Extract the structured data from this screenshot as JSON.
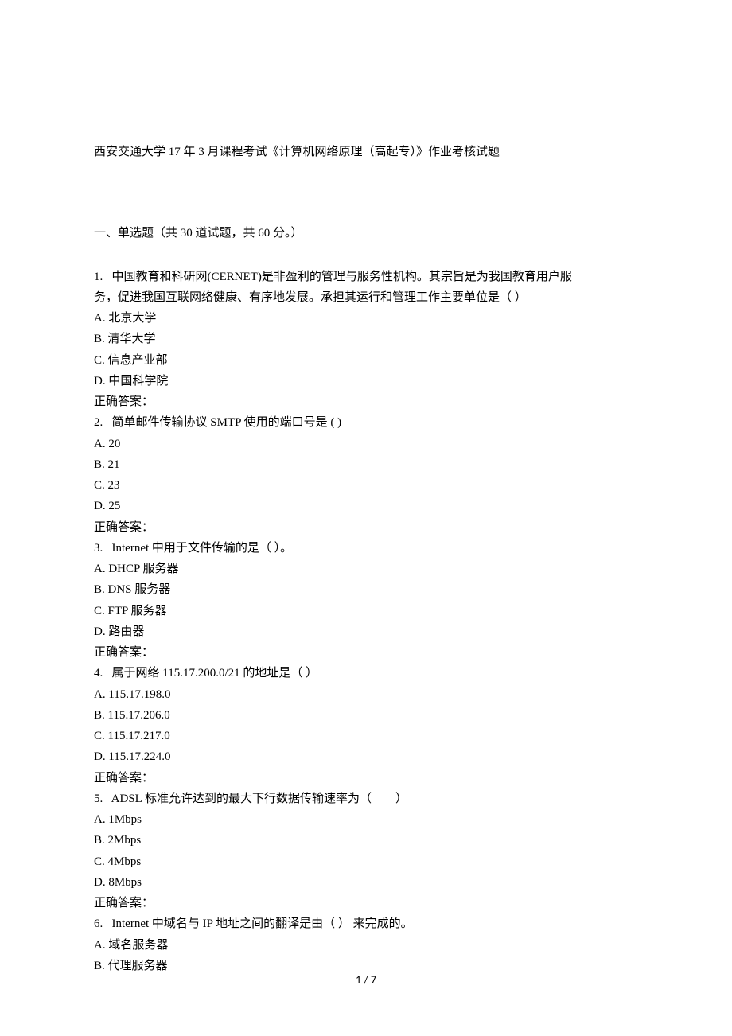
{
  "title": "西安交通大学 17 年 3 月课程考试《计算机网络原理（高起专）》作业考核试题",
  "section_header": "一、单选题（共 30 道试题，共 60 分。）",
  "questions": [
    {
      "num": "1.",
      "stem_lines": [
        "中国教育和科研网(CERNET)是非盈利的管理与服务性机构。其宗旨是为我国教育用户服",
        "务，促进我国互联网络健康、有序地发展。承担其运行和管理工作主要单位是（ ）"
      ],
      "options": [
        "A. 北京大学",
        "B. 清华大学",
        "C. 信息产业部",
        "D. 中国科学院"
      ],
      "answer_label": "正确答案："
    },
    {
      "num": "2.",
      "stem_lines": [
        "简单邮件传输协议 SMTP 使用的端口号是 ( )"
      ],
      "options": [
        "A. 20",
        "B. 21",
        "C. 23",
        "D. 25"
      ],
      "answer_label": "正确答案："
    },
    {
      "num": "3.",
      "stem_lines": [
        "Internet 中用于文件传输的是（ ）。"
      ],
      "options": [
        "A. DHCP 服务器",
        "B. DNS 服务器",
        "C. FTP 服务器",
        "D. 路由器"
      ],
      "answer_label": "正确答案："
    },
    {
      "num": "4.",
      "stem_lines": [
        "属于网络 115.17.200.0/21 的地址是（ ）"
      ],
      "options": [
        "A. 115.17.198.0",
        "B. 115.17.206.0",
        "C. 115.17.217.0",
        "D. 115.17.224.0"
      ],
      "answer_label": "正确答案："
    },
    {
      "num": "5.",
      "stem_lines": [
        "ADSL 标准允许达到的最大下行数据传输速率为（        ）"
      ],
      "options": [
        "A. 1Mbps",
        "B. 2Mbps",
        "C. 4Mbps",
        "D. 8Mbps"
      ],
      "answer_label": "正确答案："
    },
    {
      "num": "6.",
      "stem_lines": [
        "Internet 中域名与 IP 地址之间的翻译是由（ ） 来完成的。"
      ],
      "options": [
        "A. 域名服务器",
        "B. 代理服务器"
      ],
      "answer_label": null
    }
  ],
  "page_number": "1 / 7"
}
